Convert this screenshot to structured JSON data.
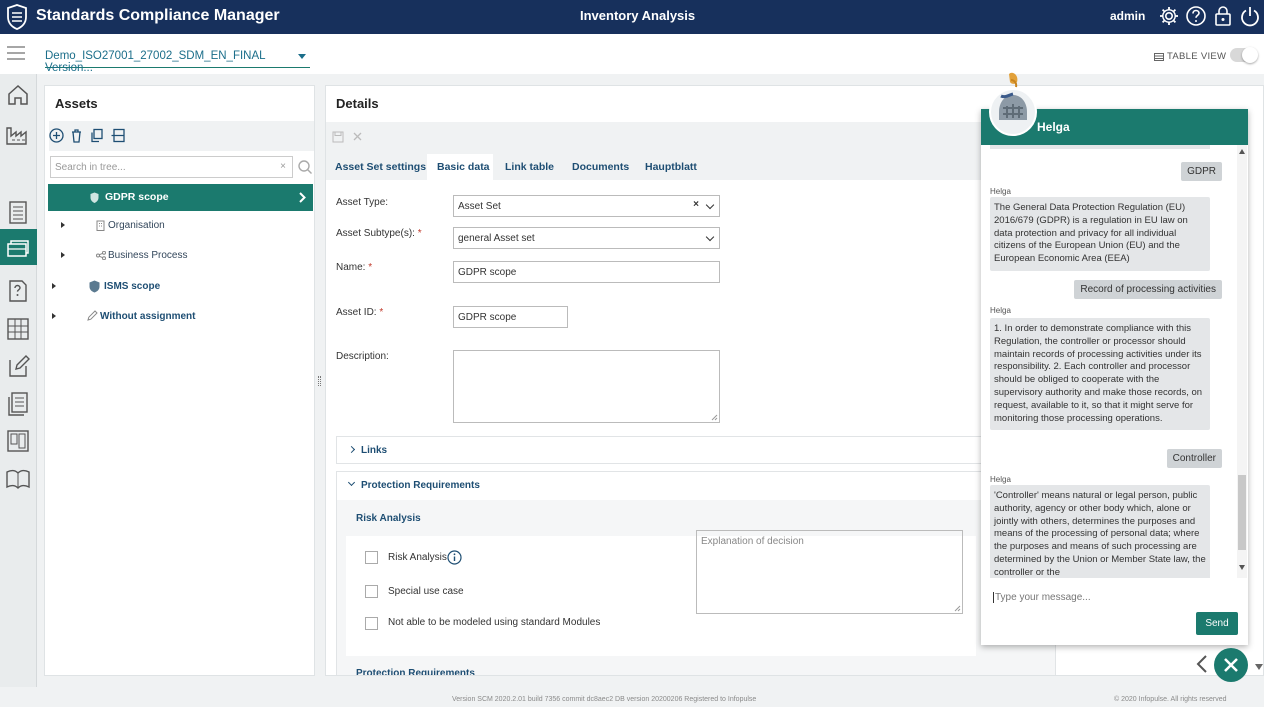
{
  "app": {
    "title": "Standards Compliance Manager",
    "page_title": "Inventory Analysis",
    "user": "admin"
  },
  "subbar": {
    "version_select": "Demo_ISO27001_27002_SDM_EN_FINAL Version...",
    "table_view_label": "TABLE VIEW"
  },
  "assets": {
    "title": "Assets",
    "search_placeholder": "Search in tree...",
    "tree": {
      "selected": "GDPR scope",
      "organisation": "Organisation",
      "business_process": "Business Process",
      "isms": "ISMS scope",
      "without": "Without assignment"
    }
  },
  "details": {
    "title": "Details",
    "tabs": [
      "Asset Set settings",
      "Basic data",
      "Link table",
      "Documents",
      "Hauptblatt"
    ],
    "fields": {
      "asset_type_label": "Asset Type:",
      "asset_type_value": "Asset Set",
      "asset_subtype_label": "Asset Subtype(s):",
      "asset_subtype_value": "general Asset set",
      "name_label": "Name:",
      "name_value": "GDPR scope",
      "asset_id_label": "Asset ID:",
      "asset_id_value": "GDPR scope",
      "description_label": "Description:",
      "required_mark": "*"
    },
    "sections": {
      "links": "Links",
      "protection_requirements": "Protection Requirements",
      "risk_analysis_header": "Risk Analysis",
      "risk_analysis_cb": "Risk Analysis",
      "special_use_case": "Special use case",
      "not_modeled": "Not able to be modeled using standard Modules",
      "explanation_placeholder": "Explanation of decision",
      "protection_requirements_sub": "Protection Requirements"
    }
  },
  "chat": {
    "name": "Helga",
    "sender": "Helga",
    "messages": [
      {
        "from": "user",
        "text": "GDPR"
      },
      {
        "from": "bot",
        "text": "The General Data Protection Regulation (EU) 2016/679 (GDPR) is a regulation in EU law on data protection and privacy for all individual citizens of the European Union (EU) and the European Economic Area (EEA)"
      },
      {
        "from": "user",
        "text": "Record of processing activities"
      },
      {
        "from": "bot",
        "text": "1. In order to demonstrate compliance with this Regulation, the controller or processor should maintain records of processing activities under its responsibility. 2. Each controller and processor should be obliged to cooperate with the supervisory authority and make those records, on request, available to it, so that it might serve for monitoring those processing operations."
      },
      {
        "from": "user",
        "text": "Controller"
      },
      {
        "from": "bot",
        "text": "'Controller' means natural or legal person, public authority, agency or other body which, alone or jointly with others, determines the purposes and means of the processing of personal data; where the purposes and means of such processing are determined by the Union or Member State law, the controller or the"
      }
    ],
    "input_placeholder": "Type your message...",
    "send_label": "Send"
  },
  "footer": {
    "version": "Version SCM 2020.2.01 build 7356 commit dc8aec2   DB version 20200206   Registered to Infopulse",
    "copyright": "© 2020 Infopulse. All rights reserved"
  },
  "colors": {
    "navy": "#17305c",
    "teal": "#1b7a6e"
  },
  "icons": [
    "shield-logo-icon",
    "settings-icon",
    "help-icon",
    "lock-icon",
    "power-icon",
    "menu-icon",
    "home-icon",
    "factory-icon",
    "assets-icon",
    "checklist-icon",
    "question-list-icon",
    "grid-icon",
    "edit-doc-icon",
    "documents-icon",
    "board-icon",
    "book-icon",
    "add-icon",
    "delete-icon",
    "copy-icon",
    "structure-icon",
    "search-icon",
    "shield-icon",
    "building-icon",
    "process-icon",
    "pencil-icon",
    "chevron-right-icon",
    "info-icon",
    "close-icon",
    "chevron-left-icon"
  ]
}
